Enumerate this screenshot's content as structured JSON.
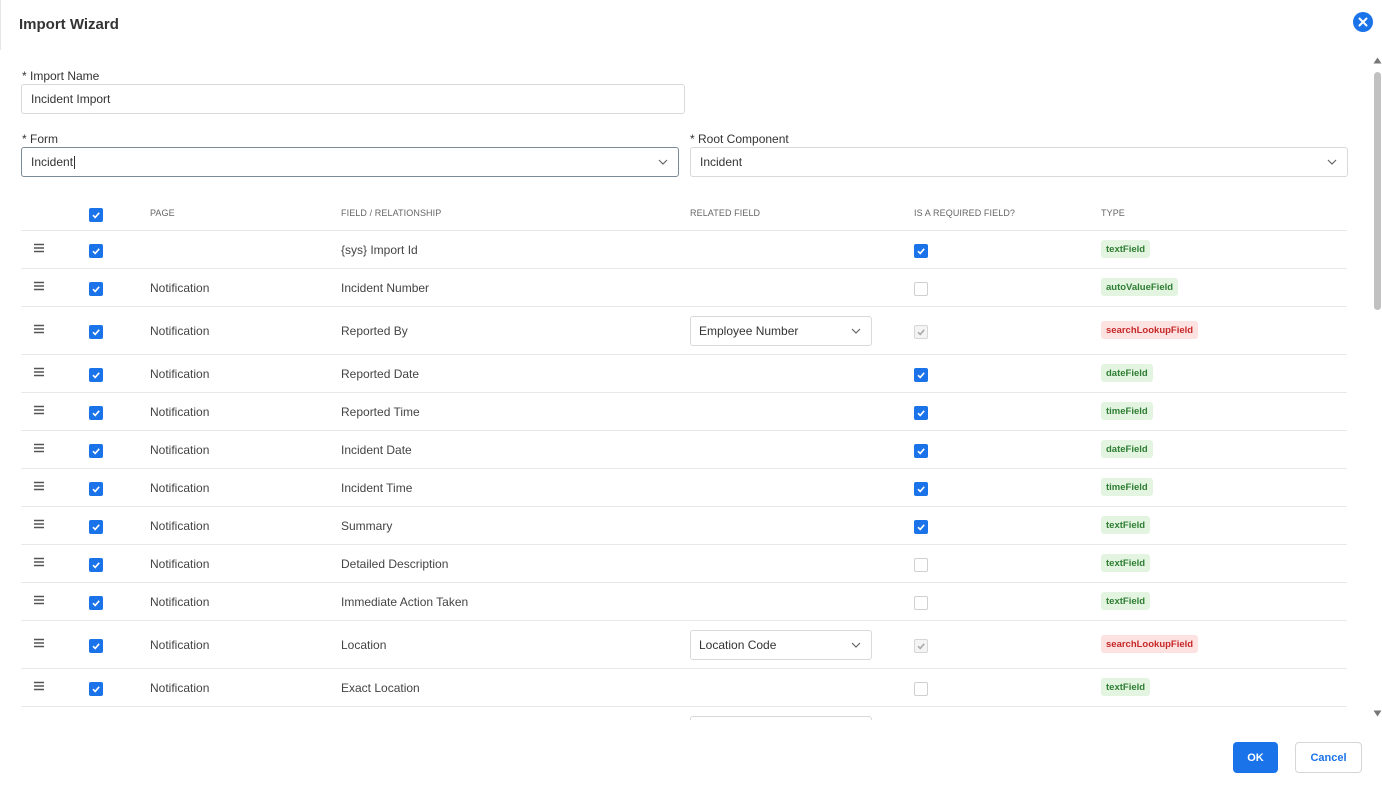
{
  "dialog": {
    "title": "Import Wizard"
  },
  "form": {
    "import_name_label": "* Import Name",
    "import_name_value": "Incident Import",
    "form_label": "* Form",
    "form_value": "Incident",
    "root_label": "* Root Component",
    "root_value": "Incident"
  },
  "table": {
    "headers": {
      "page": "PAGE",
      "field": "FIELD / RELATIONSHIP",
      "related": "RELATED FIELD",
      "required": "IS A REQUIRED FIELD?",
      "type": "TYPE"
    },
    "rows": [
      {
        "page": "",
        "field": "{sys} Import Id",
        "related": "",
        "required": "checked",
        "type": "textField",
        "type_color": "green"
      },
      {
        "page": "Notification",
        "field": "Incident Number",
        "related": "",
        "required": "unchecked",
        "type": "autoValueField",
        "type_color": "green"
      },
      {
        "page": "Notification",
        "field": "Reported By",
        "related": "Employee Number",
        "required": "disabled-checked",
        "type": "searchLookupField",
        "type_color": "red"
      },
      {
        "page": "Notification",
        "field": "Reported Date",
        "related": "",
        "required": "checked",
        "type": "dateField",
        "type_color": "green"
      },
      {
        "page": "Notification",
        "field": "Reported Time",
        "related": "",
        "required": "checked",
        "type": "timeField",
        "type_color": "green"
      },
      {
        "page": "Notification",
        "field": "Incident Date",
        "related": "",
        "required": "checked",
        "type": "dateField",
        "type_color": "green"
      },
      {
        "page": "Notification",
        "field": "Incident Time",
        "related": "",
        "required": "checked",
        "type": "timeField",
        "type_color": "green"
      },
      {
        "page": "Notification",
        "field": "Summary",
        "related": "",
        "required": "checked",
        "type": "textField",
        "type_color": "green"
      },
      {
        "page": "Notification",
        "field": "Detailed Description",
        "related": "",
        "required": "unchecked",
        "type": "textField",
        "type_color": "green"
      },
      {
        "page": "Notification",
        "field": "Immediate Action Taken",
        "related": "",
        "required": "unchecked",
        "type": "textField",
        "type_color": "green"
      },
      {
        "page": "Notification",
        "field": "Location",
        "related": "Location Code",
        "required": "disabled-checked",
        "type": "searchLookupField",
        "type_color": "red"
      },
      {
        "page": "Notification",
        "field": "Exact Location",
        "related": "",
        "required": "unchecked",
        "type": "textField",
        "type_color": "green"
      }
    ]
  },
  "footer": {
    "ok_label": "OK",
    "cancel_label": "Cancel"
  },
  "colors": {
    "accent": "#1a73e8",
    "green_badge": "#2e7d32",
    "red_badge": "#c62828"
  }
}
